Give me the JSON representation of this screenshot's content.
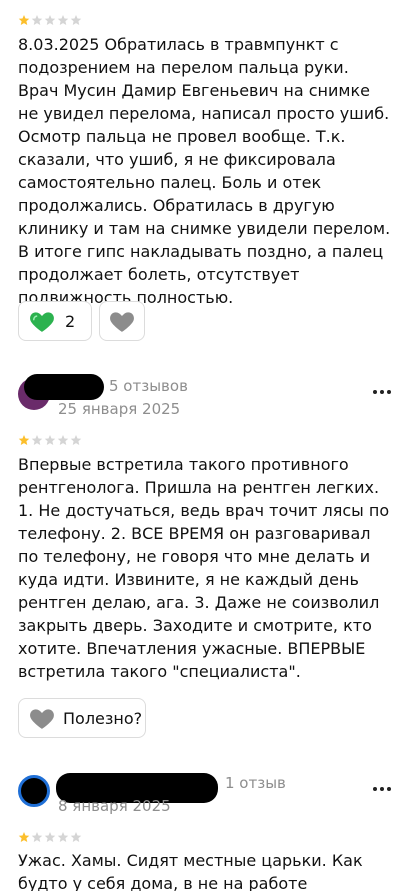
{
  "reviews": [
    {
      "rating": 1,
      "text": "8.03.2025 Обратилась в травмпункт с подозрением на перелом пальца руки. Врач Мусин Дамир Евгеньевич на снимке не увидел перелома, написал просто ушиб. Осмотр пальца не провел вообще. Т.к. сказали, что ушиб, я не фиксировала самостоятельно палец. Боль и отек продолжались. Обратилась в другую клинику и там на снимке увидели перелом. В итоге гипс накладывать поздно, а палец продолжает болеть, отсутствует подвижность полностью.",
      "likes": "2",
      "like_icon": "green-heart-icon",
      "dislike_icon": "grey-heart-icon"
    },
    {
      "review_count": "5 отзывов",
      "date": "25 января 2025",
      "rating": 1,
      "text": "Впервые встретила такого противного рентгенолога. Пришла на рентген легких. 1. Не достучаться, ведь врач точит лясы по телефону. 2. ВСЕ ВРЕМЯ он разговаривал по телефону, не говоря что мне делать и куда идти. Извините, я не каждый день рентген делаю, ага. 3. Даже не соизволил закрыть дверь. Заходите и смотрите, кто хотите. Впечатления ужасные. ВПЕРВЫЕ встретила такого \"специалиста\".",
      "useful_label": "Полезно?"
    },
    {
      "review_count": "1 отзыв",
      "date": "8 января 2025",
      "rating": 1,
      "text": "Ужас. Хамы. Сидят местные царьки. Как будто у себя дома, в не на работе"
    }
  ],
  "colors": {
    "star_active": "#fcbf2c",
    "star_inactive": "#d5d5d5",
    "heart_green": "#2cb24f",
    "heart_grey": "#8c8c8c",
    "secondary_text": "#8e8e8e",
    "avatar_ring": "#1f6fd6"
  }
}
